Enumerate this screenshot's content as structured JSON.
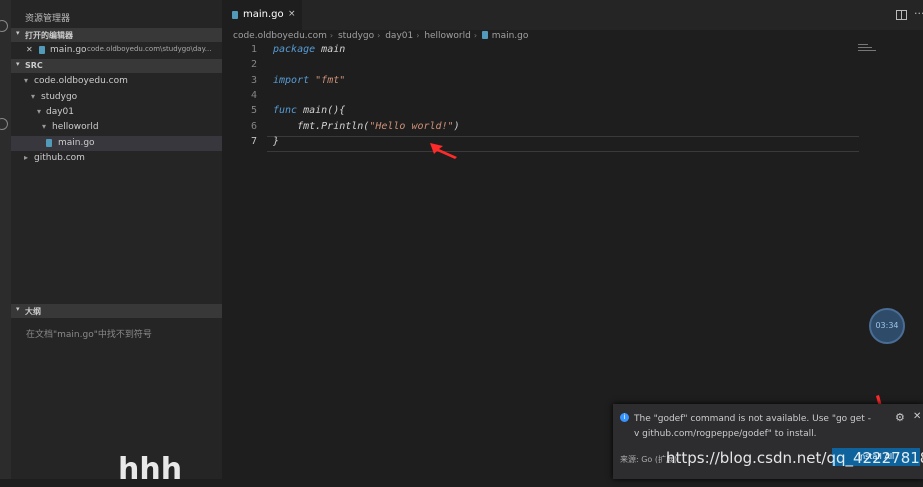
{
  "sidebar": {
    "title": "资源管理器",
    "open_editors_header": "打开的编辑器",
    "open_editor": {
      "close": "✕",
      "file": "main.go",
      "path": "code.oldboyedu.com\\studygo\\day..."
    },
    "src_header": "SRC",
    "tree": [
      {
        "arrow": "▾",
        "label": "code.oldboyedu.com"
      },
      {
        "arrow": "▾",
        "label": "studygo"
      },
      {
        "arrow": "▾",
        "label": "day01"
      },
      {
        "arrow": "▾",
        "label": "helloworld"
      },
      {
        "arrow": "",
        "label": "main.go"
      },
      {
        "arrow": "▸",
        "label": "github.com"
      }
    ],
    "outline_header": "大纲",
    "outline_empty": "在文档\"main.go\"中找不到符号"
  },
  "tab": {
    "label": "main.go",
    "close": "×"
  },
  "breadcrumb": [
    "code.oldboyedu.com",
    "studygo",
    "day01",
    "helloworld",
    "main.go"
  ],
  "code": {
    "line_numbers": [
      "1",
      "2",
      "3",
      "4",
      "5",
      "6",
      "7"
    ],
    "l1_kw": "package",
    "l1_rest": " main",
    "l3_kw": "import",
    "l3_str": "\"fmt\"",
    "l5_kw": "func",
    "l5_rest": " main(){",
    "l6_pre": "    fmt.Println(",
    "l6_str": "\"Hello world!\"",
    "l6_post": ")",
    "l7": "}"
  },
  "clock": "03:34",
  "notification": {
    "info": "i",
    "message": "The \"godef\" command is not available. Use \"go get -v github.com/rogpeppe/godef\" to install.",
    "source": "来源: Go (扩展)",
    "install_button": "Install All",
    "gear": "⚙",
    "close": "✕"
  },
  "watermark": "https://blog.csdn.net/qq_42227818",
  "watermark2": "hhh",
  "colors": {
    "accent": "#0e639c",
    "arrow": "#ff2a2a"
  }
}
